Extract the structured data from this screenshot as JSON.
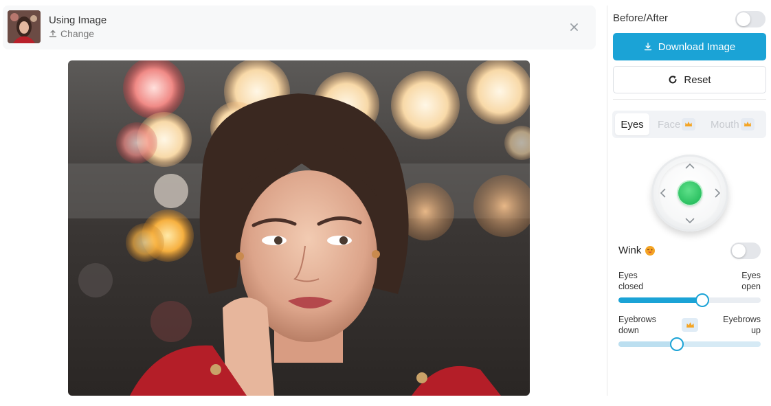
{
  "file": {
    "title": "Using Image",
    "change_label": "Change"
  },
  "panel": {
    "before_after_label": "Before/After",
    "before_after_on": false,
    "download_label": "Download Image",
    "reset_label": "Reset",
    "tabs": [
      {
        "label": "Eyes",
        "active": true,
        "premium": false
      },
      {
        "label": "Face",
        "active": false,
        "premium": true
      },
      {
        "label": "Mouth",
        "active": false,
        "premium": true
      }
    ],
    "wink_label": "Wink",
    "wink_on": false,
    "sliders": [
      {
        "left_line1": "Eyes",
        "left_line2": "closed",
        "right_line1": "Eyes",
        "right_line2": "open",
        "value": 0.59
      },
      {
        "left_line1": "Eyebrows",
        "left_line2": "down",
        "right_line1": "Eyebrows",
        "right_line2": "up",
        "value": 0.41,
        "premium": true
      }
    ]
  },
  "colors": {
    "accent": "#1ba3d6",
    "joystick_knob": "#2cc162",
    "crown": "#f4a424"
  },
  "icons": [
    "upload-icon",
    "close-icon",
    "download-icon",
    "refresh-icon",
    "crown-icon",
    "chevron-up-icon",
    "chevron-down-icon",
    "chevron-left-icon",
    "chevron-right-icon",
    "wink-emoji-icon"
  ]
}
